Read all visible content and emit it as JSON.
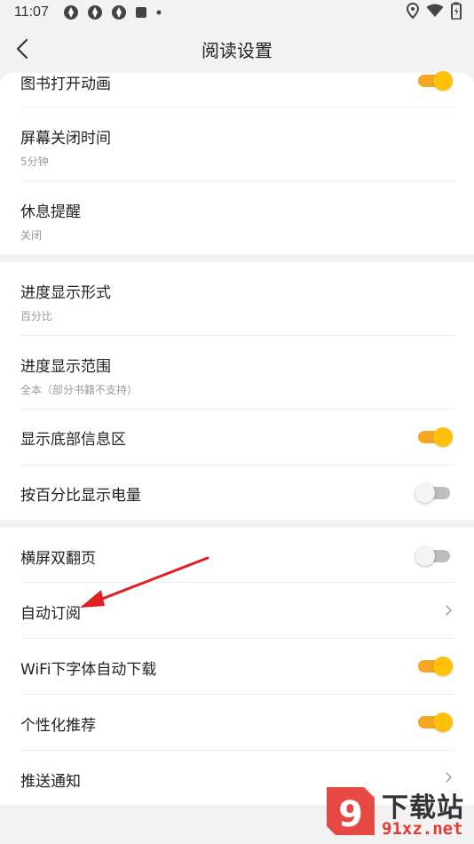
{
  "status_bar": {
    "time": "11:07",
    "left_icons": [
      "app-icon",
      "app-icon",
      "app-icon",
      "square-icon",
      "dot-icon"
    ],
    "right_icons": [
      "location-icon",
      "wifi-icon",
      "battery-icon"
    ]
  },
  "header": {
    "title": "阅读设置",
    "back_icon": "chevron-left-icon"
  },
  "groups": [
    {
      "items": [
        {
          "label": "图书打开动画",
          "control": "toggle",
          "state": "on"
        },
        {
          "label": "屏幕关闭时间",
          "value": "5分钟",
          "control": "none"
        },
        {
          "label": "休息提醒",
          "value": "关闭",
          "control": "none"
        }
      ]
    },
    {
      "items": [
        {
          "label": "进度显示形式",
          "value": "百分比",
          "control": "none"
        },
        {
          "label": "进度显示范围",
          "value": "全本（部分书籍不支持）",
          "control": "none"
        },
        {
          "label": "显示底部信息区",
          "control": "toggle",
          "state": "on"
        },
        {
          "label": "按百分比显示电量",
          "control": "toggle",
          "state": "off"
        }
      ]
    },
    {
      "items": [
        {
          "label": "横屏双翻页",
          "control": "toggle",
          "state": "off"
        },
        {
          "label": "自动订阅",
          "control": "chevron"
        },
        {
          "label": "WiFi下字体自动下载",
          "control": "toggle",
          "state": "on"
        },
        {
          "label": "个性化推荐",
          "control": "toggle",
          "state": "on"
        },
        {
          "label": "推送通知",
          "control": "chevron"
        }
      ]
    }
  ],
  "annotation": {
    "arrow_color": "#e02020",
    "points_to": "自动订阅"
  },
  "watermark": {
    "line1": "下载站",
    "line2": "91xz.net",
    "logo_glyph": "9"
  },
  "colors": {
    "accent": "#ffc107",
    "background": "#f2f2f2",
    "sub_text": "#999999"
  }
}
